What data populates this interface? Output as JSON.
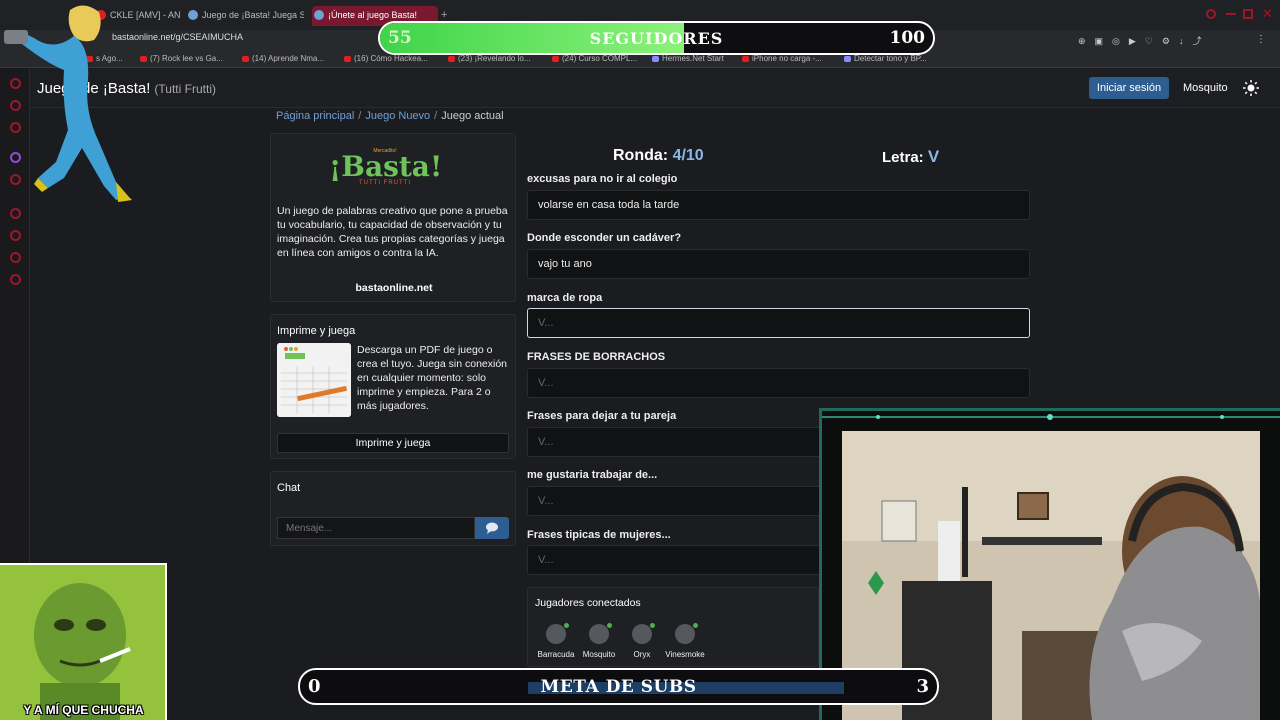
{
  "browser": {
    "tabs": [
      {
        "label": "CKLE [AMV] - ANIM",
        "active": false
      },
      {
        "label": "Juego de ¡Basta! Juega St",
        "active": false
      },
      {
        "label": "¡Únete al juego Basta!",
        "active": true
      }
    ],
    "url": "bastaonline.net/g/CSEAIMUCHA",
    "bookmarks": [
      "s Ago...",
      "(7) Rock lee vs Ga...",
      "(14) Aprende Nma...",
      "(16) Cómo Hackea...",
      "(23) ¡Revelando lo...",
      "(24) Curso COMPL...",
      "Hermes.Net Start",
      "iPhone no carga -...",
      "Detectar tono y BP..."
    ]
  },
  "header": {
    "title": "Juego de ¡Basta!",
    "subtitle": "(Tutti Frutti)",
    "login_label": "Iniciar sesión",
    "username": "Mosquito"
  },
  "breadcrumb": {
    "home": "Página principal",
    "new_game": "Juego Nuevo",
    "current": "Juego actual"
  },
  "about": {
    "logo_top": "Mercadito!",
    "logo_main": "¡Basta!",
    "logo_bottom": "TUTTI FRUTTI",
    "text": "Un juego de palabras creativo que pone a prueba tu vocabulario, tu capacidad de observación y tu imaginación. Crea tus propias categorías y juega en línea con amigos o contra la IA.",
    "site": "bastaonline.net"
  },
  "print": {
    "title": "Imprime y juega",
    "text": "Descarga un PDF de juego o crea el tuyo. Juega sin conexión en cualquier momento: solo imprime y empieza. Para 2 o más jugadores.",
    "button": "Imprime y juega"
  },
  "chat": {
    "title": "Chat",
    "placeholder": "Mensaje..."
  },
  "game": {
    "round_label": "Ronda:",
    "round_value": "4/10",
    "letter_label": "Letra:",
    "letter_value": "V",
    "categories": [
      {
        "label": "excusas para no ir al colegio",
        "value": "volarse en casa toda la tarde",
        "placeholder": "V..."
      },
      {
        "label": "Donde esconder un cadáver?",
        "value": "vajo tu ano",
        "placeholder": "V..."
      },
      {
        "label": "marca de ropa",
        "value": "",
        "placeholder": "V..."
      },
      {
        "label": "FRASES DE BORRACHOS",
        "value": "",
        "placeholder": "V..."
      },
      {
        "label": "Frases para dejar a tu pareja",
        "value": "",
        "placeholder": "V..."
      },
      {
        "label": "me gustaria trabajar de...",
        "value": "",
        "placeholder": "V..."
      },
      {
        "label": "Frases tipicas de mujeres...",
        "value": "",
        "placeholder": "V..."
      }
    ]
  },
  "players": {
    "title": "Jugadores conectados",
    "list": [
      "Barracuda",
      "Mosquito",
      "Oryx",
      "Vinesmoke"
    ]
  },
  "overlay": {
    "followers": {
      "label": "SEGUIDORES",
      "current": "55",
      "goal": "100",
      "progress": 0.55
    },
    "subs": {
      "label": "META DE SUBS",
      "current": "0",
      "goal": "3"
    },
    "meme_caption": "Y A MÍ QUE CHUCHA"
  },
  "colors": {
    "accent": "#2d5d91",
    "highlight": "#8bb8ea",
    "follower_bar": "#3fd44a",
    "webcam_border": "#1f6a5a"
  }
}
